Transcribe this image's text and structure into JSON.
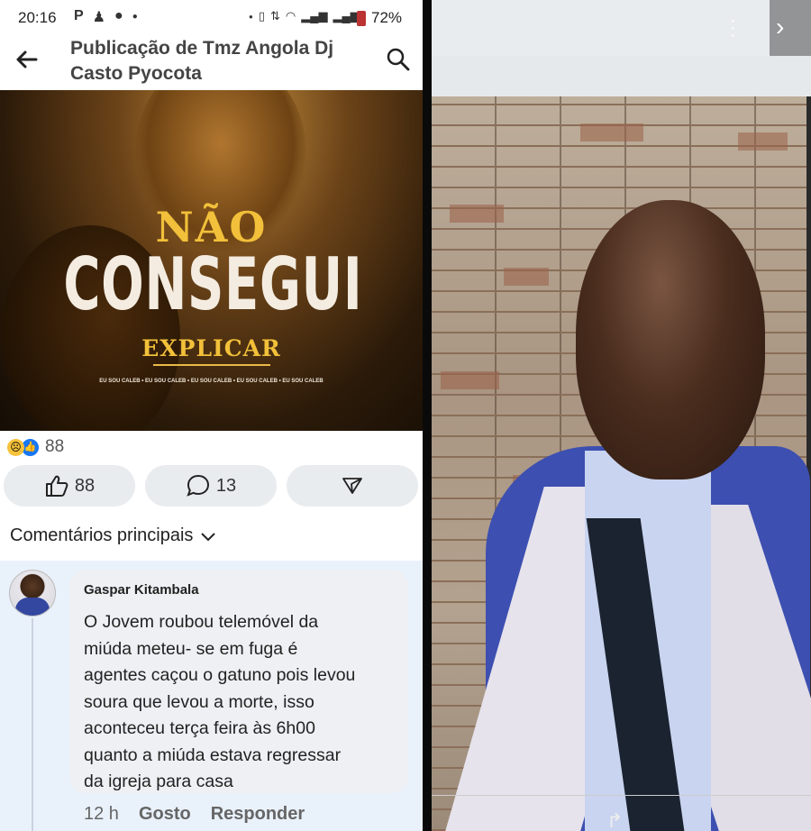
{
  "status_bar": {
    "time": "20:16",
    "left_icons": [
      "p-icon",
      "snapchat-icon",
      "chat-icon",
      "dot-icon"
    ],
    "battery_pct": "72%"
  },
  "header": {
    "title_line1": "Publicação de Tmz Angola Dj",
    "title_line2": "Casto Pyocota"
  },
  "poster": {
    "line1": "NÃO",
    "line2": "CONSEGUI",
    "line3": "EXPLICAR",
    "credit": "EU SOU CALEB • EU SOU CALEB • EU SOU CALEB • EU SOU CALEB • EU SOU CALEB"
  },
  "reactions": {
    "count": "88",
    "icons": [
      "sad-reaction-icon",
      "like-reaction-icon"
    ]
  },
  "actions": {
    "like_count": "88",
    "comment_count": "13"
  },
  "comments_header": "Comentários principais",
  "comment": {
    "author": "Gaspar Kitambala",
    "text_lines": [
      "O Jovem roubou telemóvel da",
      "miúda meteu- se em fuga é",
      "agentes caçou o gatuno pois levou",
      "soura que levou a morte, isso",
      "aconteceu terça feira às 6h00",
      "quanto a miúda estava regressar",
      "da igreja para casa"
    ],
    "time": "12 h",
    "like_label": "Gosto",
    "reply_label": "Responder"
  },
  "colors": {
    "like_blue": "#1877f2",
    "poster_gold": "#f2c03a",
    "comment_bg": "#e9f1fb"
  }
}
